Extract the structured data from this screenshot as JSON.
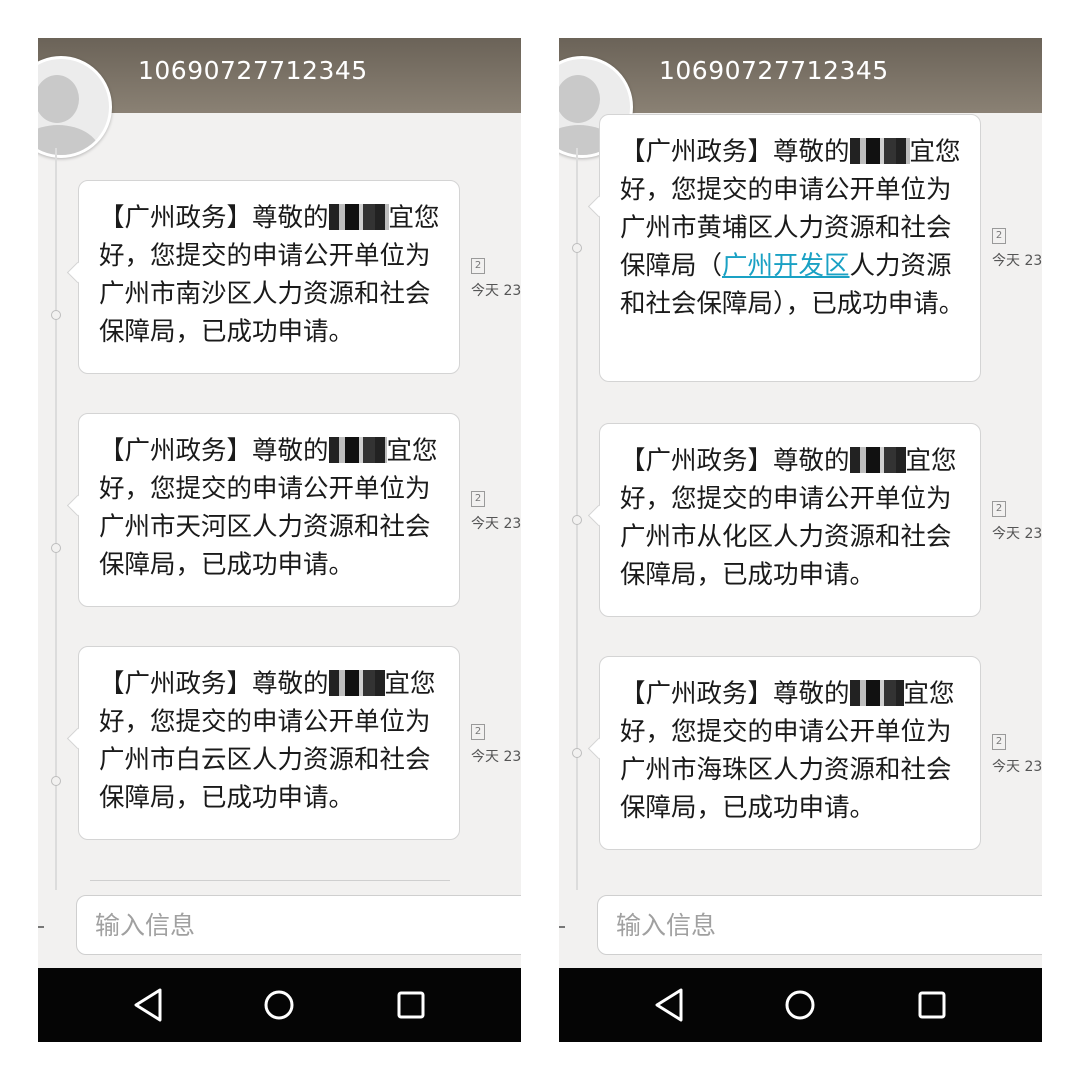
{
  "phones": [
    {
      "header": {
        "number": "10690727712345"
      },
      "messages": [
        {
          "pre": "【广州政务】尊敬的",
          "post": "宜您好，您提交的申请公开单位为广州市南沙区人力资源和社会保障局，已成功申请。",
          "sim": "2",
          "time": "今天 23"
        },
        {
          "pre": "【广州政务】尊敬的",
          "post": "宜您好，您提交的申请公开单位为广州市天河区人力资源和社会保障局，已成功申请。",
          "sim": "2",
          "time": "今天 23"
        },
        {
          "pre": "【广州政务】尊敬的",
          "post": "宜您好，您提交的申请公开单位为广州市白云区人力资源和社会保障局，已成功申请。",
          "sim": "2",
          "time": "今天 23"
        }
      ],
      "input": {
        "placeholder": "输入信息"
      }
    },
    {
      "header": {
        "number": "10690727712345"
      },
      "messages": [
        {
          "pre": "【广州政务】尊敬的",
          "post": "宜您好，您提交的申请公开单位为广州市黄埔区人力资源和社会保障局（",
          "link": "广州开发区",
          "post2": "人力资源和社会保障局），已成功申请。",
          "sim": "2",
          "time": "今天 23"
        },
        {
          "pre": "【广州政务】尊敬的",
          "post": "宜您好，您提交的申请公开单位为广州市从化区人力资源和社会保障局，已成功申请。",
          "sim": "2",
          "time": "今天 23"
        },
        {
          "pre": "【广州政务】尊敬的",
          "post": "宜您好，您提交的申请公开单位为广州市海珠区人力资源和社会保障局，已成功申请。",
          "sim": "2",
          "time": "今天 23"
        }
      ],
      "input": {
        "placeholder": "输入信息"
      }
    }
  ],
  "colors": {
    "header": "#6b6358",
    "link": "#1aa1c4",
    "navbar": "#050505"
  },
  "icons": [
    "avatar-icon",
    "back-icon",
    "home-icon",
    "recent-apps-icon",
    "sim-icon"
  ]
}
